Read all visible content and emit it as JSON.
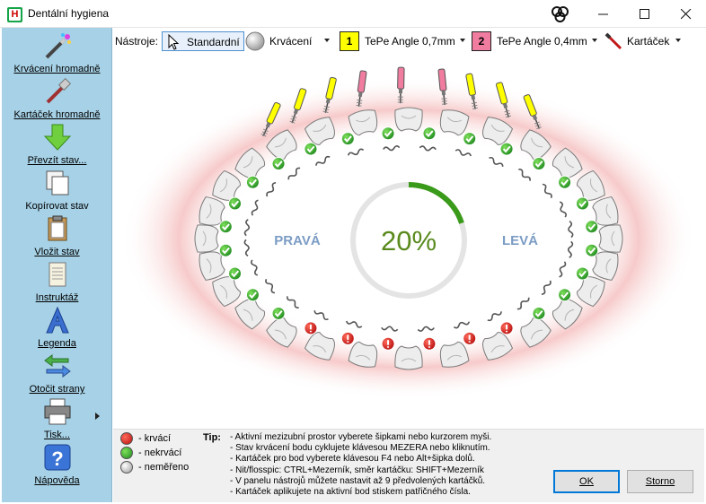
{
  "window": {
    "title": "Dentální hygiena",
    "app_icon_letter": "H"
  },
  "sidebar": {
    "items": [
      {
        "label": "Krvácení hromadně",
        "icon": "magic-wand-icon"
      },
      {
        "label": "Kartáček hromadně",
        "icon": "brush-icon"
      },
      {
        "label": "Převzít stav...",
        "icon": "arrow-down-icon"
      },
      {
        "label": "Kopírovat stav",
        "icon": "copy-icon"
      },
      {
        "label": "Vložit stav",
        "icon": "paste-icon"
      },
      {
        "label": "Instruktáž",
        "icon": "scroll-icon"
      },
      {
        "label": "Legenda",
        "icon": "letter-a-icon"
      },
      {
        "label": "Otočit strany",
        "icon": "swap-arrows-icon"
      },
      {
        "label": "Tisk...",
        "icon": "printer-icon"
      },
      {
        "label": "Nápověda",
        "icon": "help-icon"
      }
    ]
  },
  "toolbar": {
    "label": "Nástroje:",
    "standard": "Standardní",
    "bleeding": "Krvácení",
    "tepe1_num": "1",
    "tepe1": "TePe Angle 0,7mm",
    "tepe1_color": "#ffff00",
    "tepe2_num": "2",
    "tepe2": "TePe Angle 0,4mm",
    "tepe2_color": "#f07ca0",
    "brush": "Kartáček"
  },
  "chart": {
    "right_label": "PRAVÁ",
    "left_label": "LEVÁ",
    "percent": "20%",
    "progress": 0.2,
    "progress_color": "#3a9a1a",
    "percent_color": "#5a8a1e",
    "side_label_color": "#7b9cc4"
  },
  "legend": {
    "bleeding": "- krvácí",
    "not_bleeding": "- nekrvácí",
    "not_measured": "- neměřeno"
  },
  "tips": {
    "label": "Tip:",
    "lines": [
      "- Aktivní mezizubní prostor vyberete šipkami nebo kurzorem myši.",
      "- Stav krvácení bodu cyklujete klávesou MEZERA nebo kliknutím.",
      "- Kartáček pro bod vyberete klávesou F4 nebo Alt+šipka dolů.",
      "- Nit/flosspic: CTRL+Mezerník, směr kartáčku: SHIFT+Mezerník",
      "- V panelu nástrojů můžete nastavit až 9 předvolených kartáčků.",
      "- Kartáček aplikujete na aktivní bod stiskem patřičného čísla."
    ]
  },
  "buttons": {
    "ok": "OK",
    "cancel": "Storno"
  }
}
